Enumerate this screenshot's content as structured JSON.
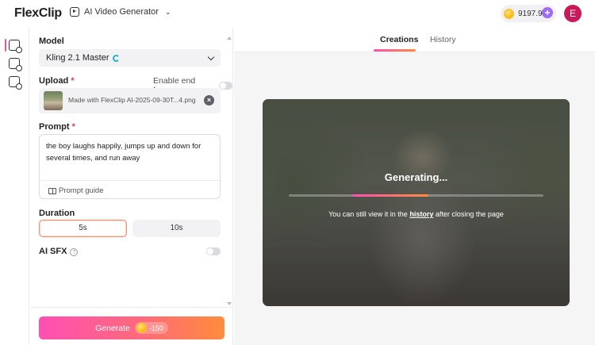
{
  "header": {
    "logo_text": "FlexClip",
    "tool_label": "AI Video Generator",
    "credits": "9197.9",
    "avatar_initial": "E"
  },
  "rail": {
    "items": [
      "ai-image-to-video-icon",
      "ai-video-icon",
      "ai-video-effects-icon"
    ]
  },
  "panel": {
    "model_label": "Model",
    "model_value": "Kling 2.1 Master",
    "upload_label": "Upload",
    "required_mark": "*",
    "end_frame_label": "Enable end frame",
    "upload_filename": "Made with FlexClip AI-2025-09-30T...4.png",
    "prompt_label": "Prompt",
    "prompt_text": "the boy  laughs happily, jumps up and down for several times, and run away",
    "prompt_guide": "Prompt guide",
    "duration_label": "Duration",
    "duration_options": [
      "5s",
      "10s"
    ],
    "duration_selected": "5s",
    "sfx_label": "AI SFX",
    "sfx_help": "?",
    "generate_label": "Generate",
    "generate_cost": "-150"
  },
  "main": {
    "tabs": [
      "Creations",
      "History"
    ],
    "active_tab": "Creations",
    "status_title": "Generating...",
    "progress": 0.3,
    "note_before": "You can still view it in the ",
    "note_link": "history",
    "note_after": " after closing the page"
  },
  "colors": {
    "accent_pink": "#ff4fb4",
    "accent_orange": "#ff8c3c",
    "avatar_bg": "#c8195a"
  }
}
